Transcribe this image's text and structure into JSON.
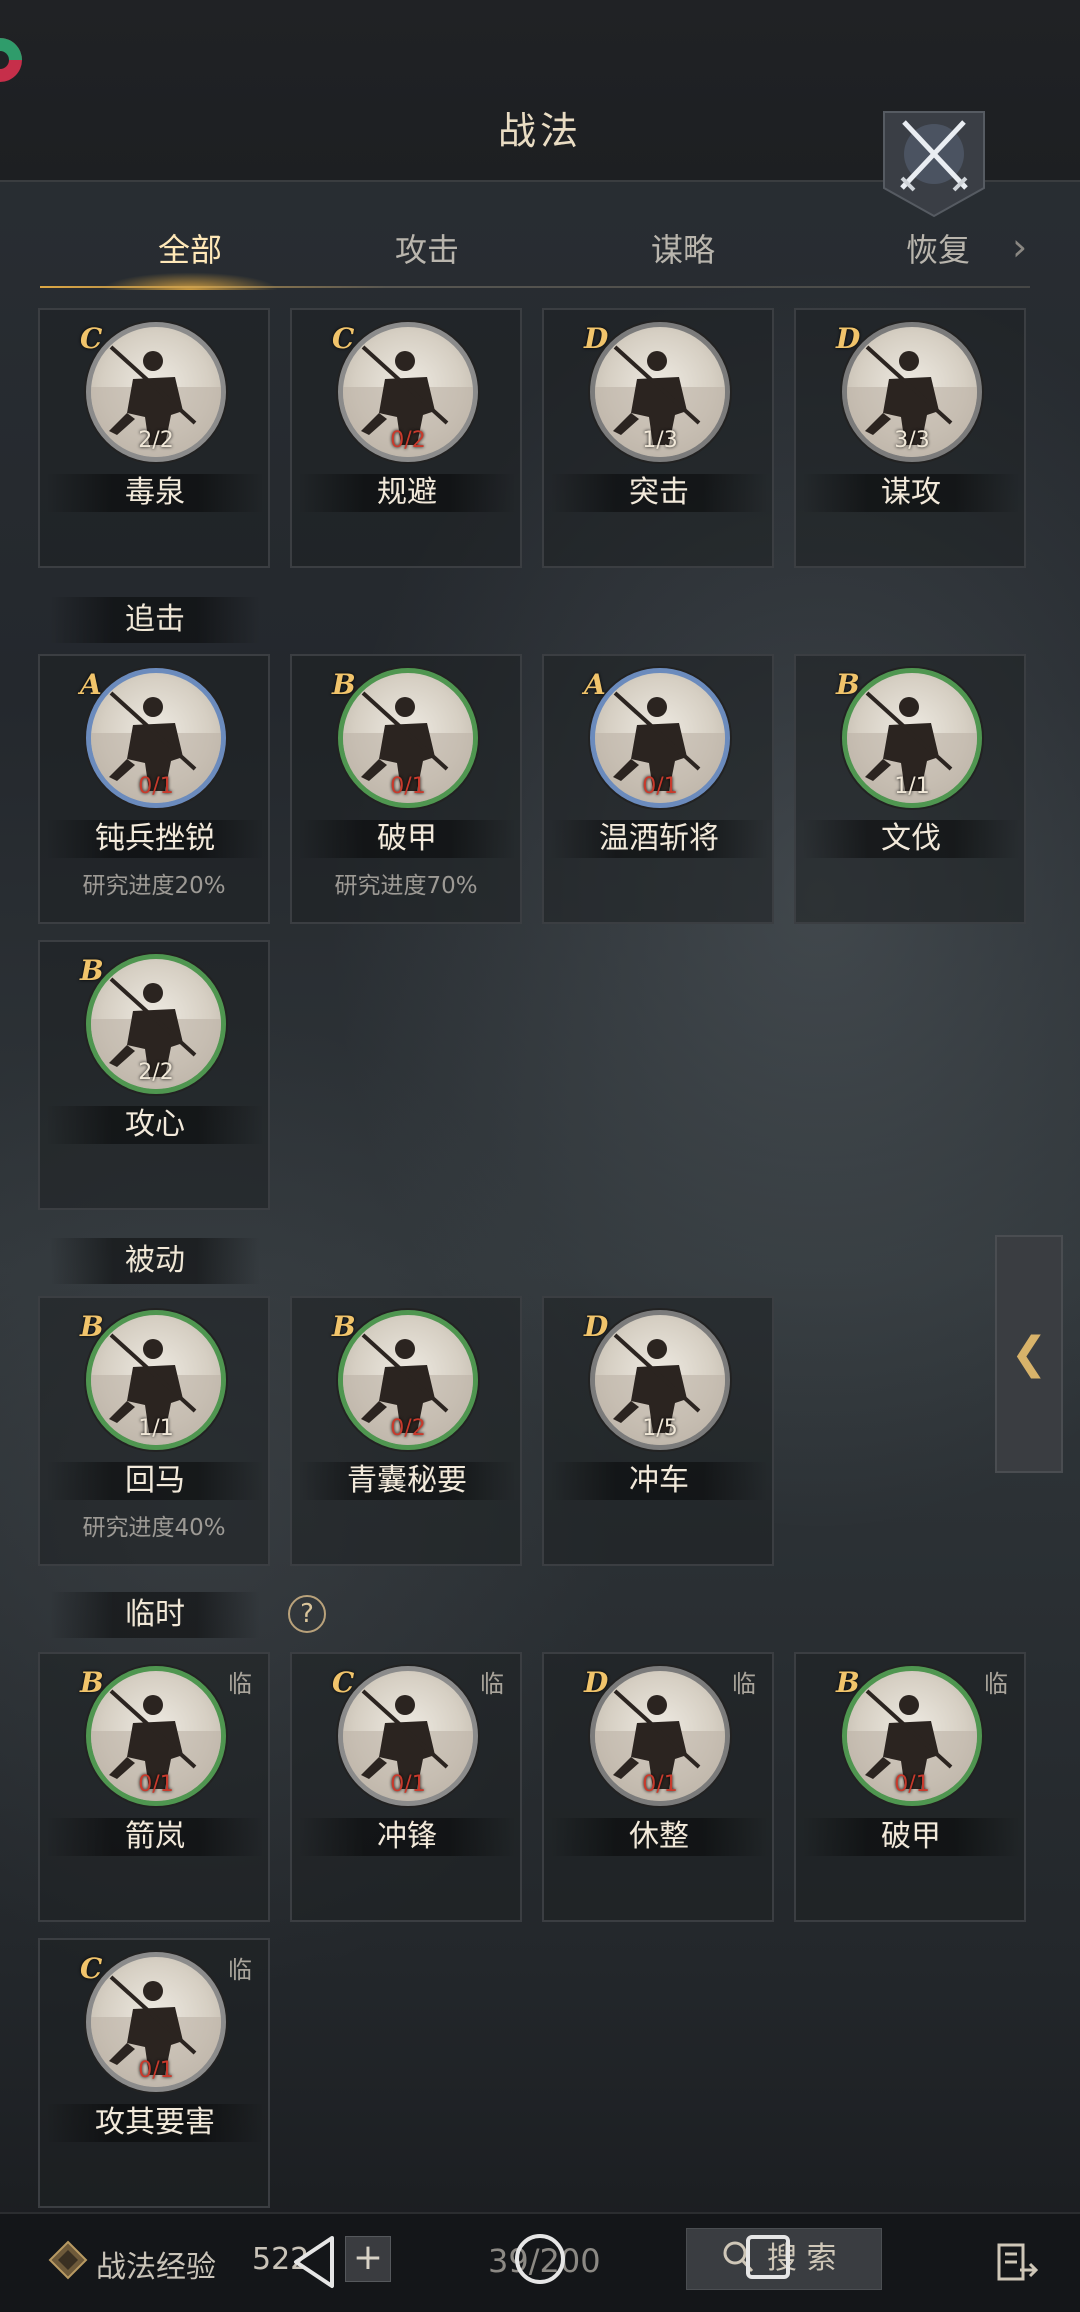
{
  "header": {
    "title": "战法"
  },
  "tabs": [
    "全部",
    "攻击",
    "谋略",
    "恢复"
  ],
  "sections": {
    "main": {
      "label": "",
      "cards": [
        {
          "grade": "C",
          "count": "2/2",
          "count_red": false,
          "name": "毒泉",
          "progress": ""
        },
        {
          "grade": "C",
          "count": "0/2",
          "count_red": true,
          "name": "规避",
          "progress": ""
        },
        {
          "grade": "D",
          "count": "1/3",
          "count_red": false,
          "name": "突击",
          "progress": ""
        },
        {
          "grade": "D",
          "count": "3/3",
          "count_red": false,
          "name": "谋攻",
          "progress": ""
        }
      ]
    },
    "pursuit": {
      "label": "追击",
      "cards": [
        {
          "grade": "A",
          "count": "0/1",
          "count_red": true,
          "name": "钝兵挫锐",
          "progress": "研究进度20%"
        },
        {
          "grade": "B",
          "count": "0/1",
          "count_red": true,
          "name": "破甲",
          "progress": "研究进度70%"
        },
        {
          "grade": "A",
          "count": "0/1",
          "count_red": true,
          "name": "温酒斩将",
          "progress": ""
        },
        {
          "grade": "B",
          "count": "1/1",
          "count_red": false,
          "name": "文伐",
          "progress": ""
        },
        {
          "grade": "B",
          "count": "2/2",
          "count_red": false,
          "name": "攻心",
          "progress": ""
        }
      ]
    },
    "passive": {
      "label": "被动",
      "cards": [
        {
          "grade": "B",
          "count": "1/1",
          "count_red": false,
          "name": "回马",
          "progress": "研究进度40%"
        },
        {
          "grade": "B",
          "count": "0/2",
          "count_red": true,
          "name": "青囊秘要",
          "progress": ""
        },
        {
          "grade": "D",
          "count": "1/5",
          "count_red": false,
          "name": "冲车",
          "progress": ""
        }
      ]
    },
    "temporary": {
      "label": "临时",
      "help": "?",
      "temp_badge": "临",
      "cards": [
        {
          "grade": "B",
          "count": "0/1",
          "count_red": true,
          "name": "箭岚",
          "progress": ""
        },
        {
          "grade": "C",
          "count": "0/1",
          "count_red": true,
          "name": "冲锋",
          "progress": ""
        },
        {
          "grade": "D",
          "count": "0/1",
          "count_red": true,
          "name": "休整",
          "progress": ""
        },
        {
          "grade": "B",
          "count": "0/1",
          "count_red": true,
          "name": "破甲",
          "progress": ""
        },
        {
          "grade": "C",
          "count": "0/1",
          "count_red": true,
          "name": "攻其要害",
          "progress": ""
        }
      ]
    }
  },
  "side_tab": {
    "arrow": "❮"
  },
  "bottom": {
    "xp_label": "战法经验",
    "xp_value": "522",
    "plus": "+",
    "capacity": "39/200",
    "search_label": "搜 索"
  },
  "icons": [
    "logo-icon",
    "crossed-swords-icon",
    "chevron-right-icon",
    "warrior-portrait-icon",
    "help-icon",
    "chevron-left-icon",
    "xp-icon",
    "search-icon",
    "exit-icon",
    "nav-back-icon",
    "nav-home-icon",
    "nav-recent-icon"
  ],
  "colors": {
    "gold": "#f1c46b",
    "red_count": "#c83a2c",
    "grade_A": "#6b8bbd",
    "grade_B": "#4f9650",
    "grade_CD": "#8b8b8b"
  }
}
